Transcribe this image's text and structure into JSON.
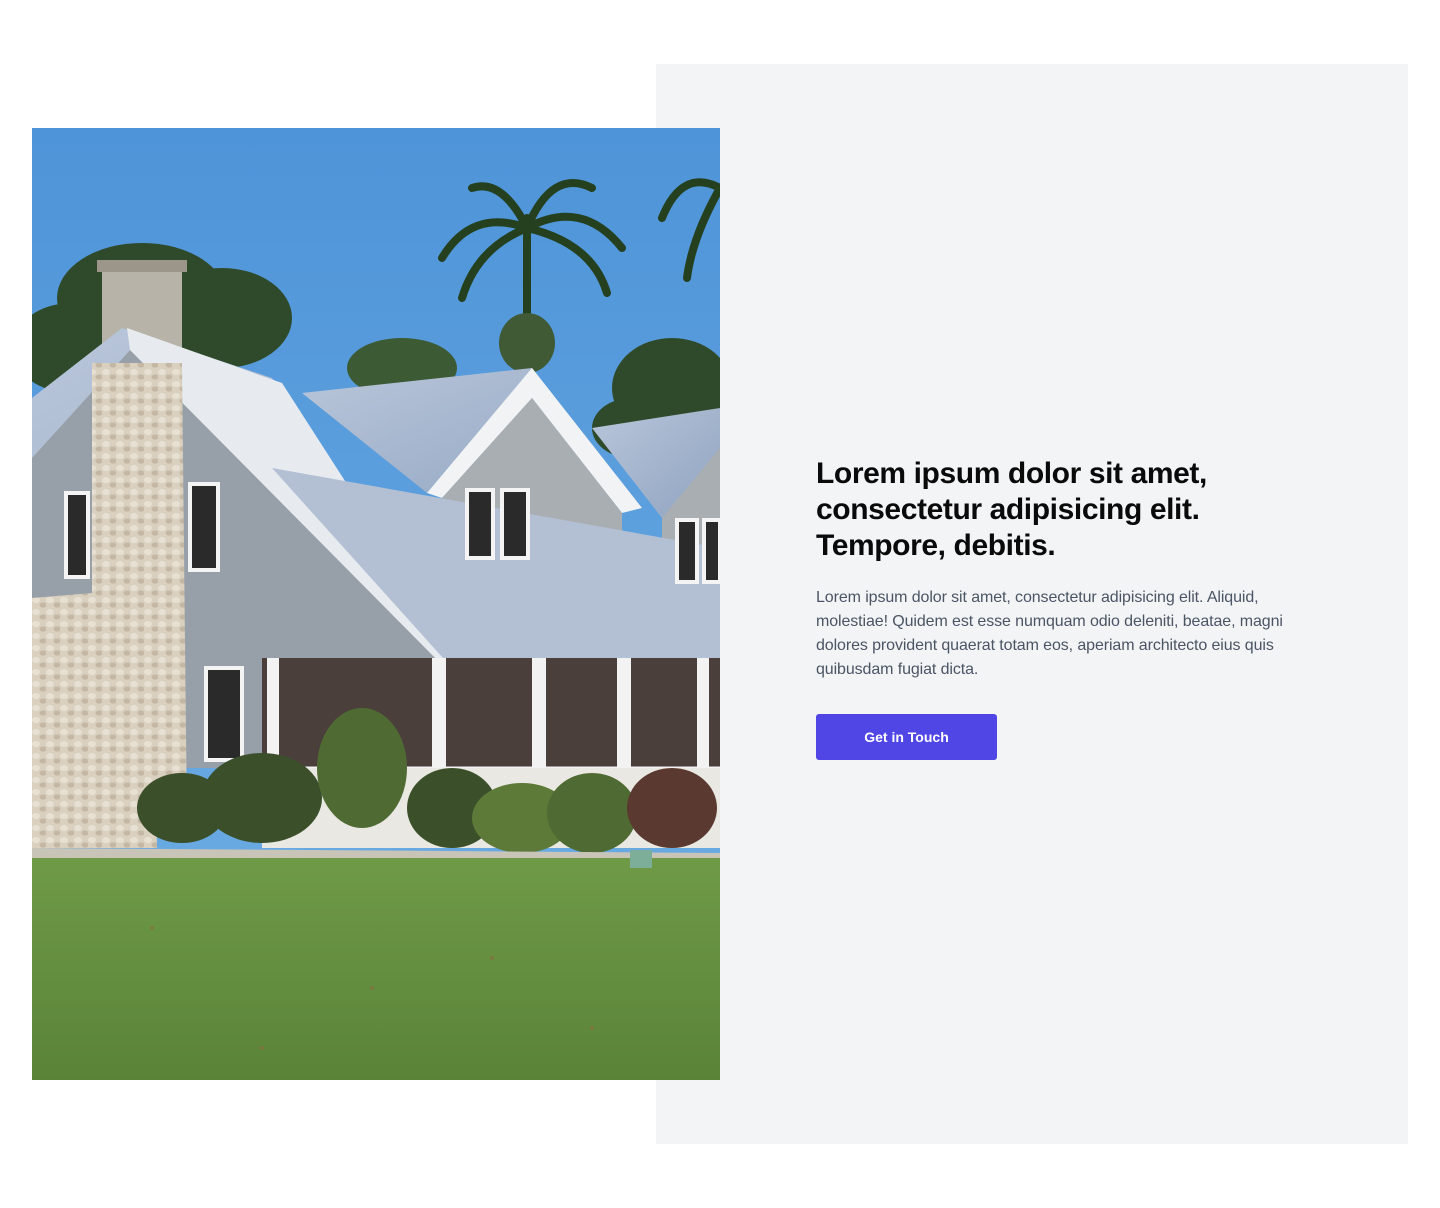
{
  "hero": {
    "image_alt": "House with stone chimney and front porch",
    "headline": "Lorem ipsum dolor sit amet, consectetur adipisicing elit. Tempore, debitis.",
    "description": "Lorem ipsum dolor sit amet, consectetur adipisicing elit. Aliquid, molestiae! Quidem est esse numquam odio deleniti, beatae, magni dolores provident quaerat totam eos, aperiam architecto eius quis quibusdam fugiat dicta.",
    "cta_label": "Get in Touch"
  },
  "colors": {
    "panel_background": "#f3f4f6",
    "button_background": "#4f46e5",
    "headline_text": "#0a0a0a",
    "body_text": "#4b5563"
  }
}
